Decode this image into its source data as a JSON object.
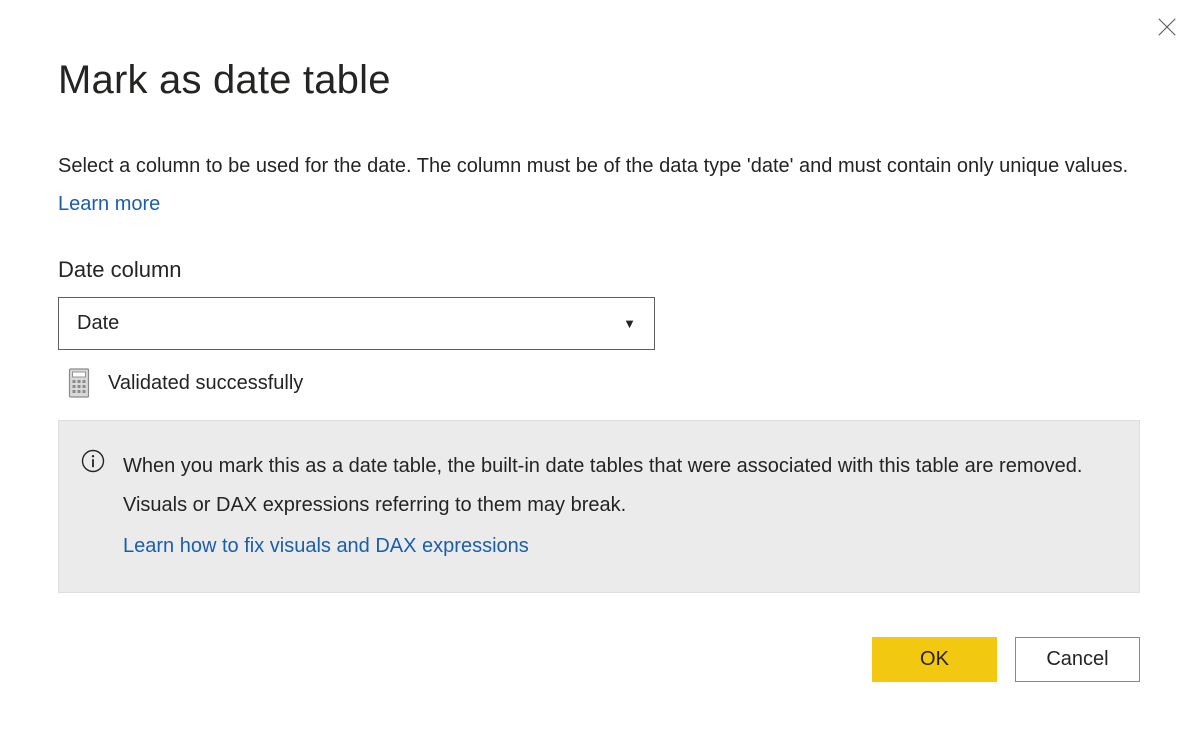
{
  "header": {
    "title": "Mark as date table"
  },
  "description": {
    "text": "Select a column to be used for the date. The column must be of the data type 'date' and must contain only unique values. ",
    "link": "Learn more"
  },
  "field": {
    "label": "Date column",
    "selected": "Date"
  },
  "validation": {
    "message": "Validated successfully"
  },
  "info": {
    "text": "When you mark this as a date table, the built-in date tables that were associated with this table are removed. Visuals or DAX expressions referring to them may break.",
    "link": "Learn how to fix visuals and DAX expressions"
  },
  "buttons": {
    "ok": "OK",
    "cancel": "Cancel"
  }
}
